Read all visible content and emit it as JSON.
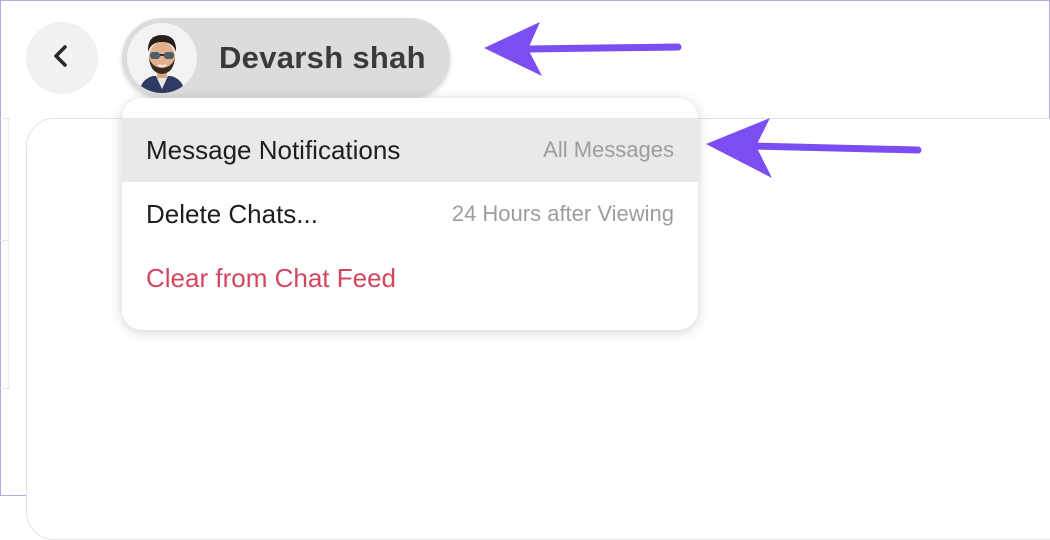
{
  "header": {
    "user_name": "Devarsh shah"
  },
  "menu": {
    "items": [
      {
        "label": "Message Notifications",
        "value": "All Messages"
      },
      {
        "label": "Delete Chats...",
        "value": "24 Hours after Viewing"
      },
      {
        "label": "Clear from Chat Feed",
        "value": ""
      }
    ]
  },
  "colors": {
    "annotation_arrow": "#7b4ef2",
    "danger_text": "#d2475e",
    "chip_background": "#dcdcdc"
  },
  "icons": {
    "back": "chevron-left-icon",
    "avatar": "bitmoji-avatar",
    "annotation": "arrow-left-icon"
  }
}
